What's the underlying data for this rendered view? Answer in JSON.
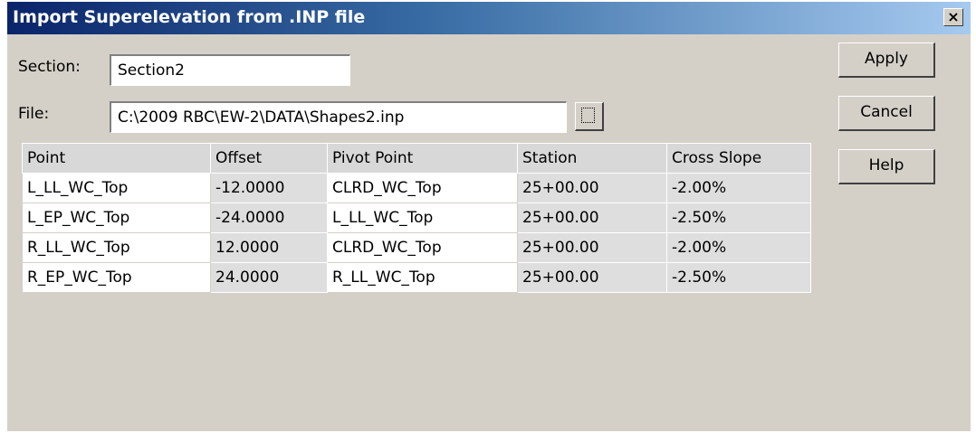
{
  "window": {
    "title": "Import Superelevation from .INP file",
    "close_glyph": "×"
  },
  "section": {
    "label": "Section:",
    "value": "Section2"
  },
  "file": {
    "label": "File:",
    "value": "C:\\2009 RBC\\EW-2\\DATA\\Shapes2.inp"
  },
  "buttons": {
    "apply": "Apply",
    "cancel": "Cancel",
    "help": "Help"
  },
  "table": {
    "columns": [
      "Point",
      "Offset",
      "Pivot Point",
      "Station",
      "Cross Slope"
    ],
    "rows": [
      [
        "L_LL_WC_Top",
        "-12.0000",
        "CLRD_WC_Top",
        "25+00.00",
        "-2.00%"
      ],
      [
        "L_EP_WC_Top",
        "-24.0000",
        "L_LL_WC_Top",
        "25+00.00",
        "-2.50%"
      ],
      [
        "R_LL_WC_Top",
        "12.0000",
        "CLRD_WC_Top",
        "25+00.00",
        "-2.00%"
      ],
      [
        "R_EP_WC_Top",
        "24.0000",
        "R_LL_WC_Top",
        "25+00.00",
        "-2.50%"
      ]
    ]
  },
  "icons": {
    "close": "close-icon",
    "browse": "browse-icon"
  }
}
